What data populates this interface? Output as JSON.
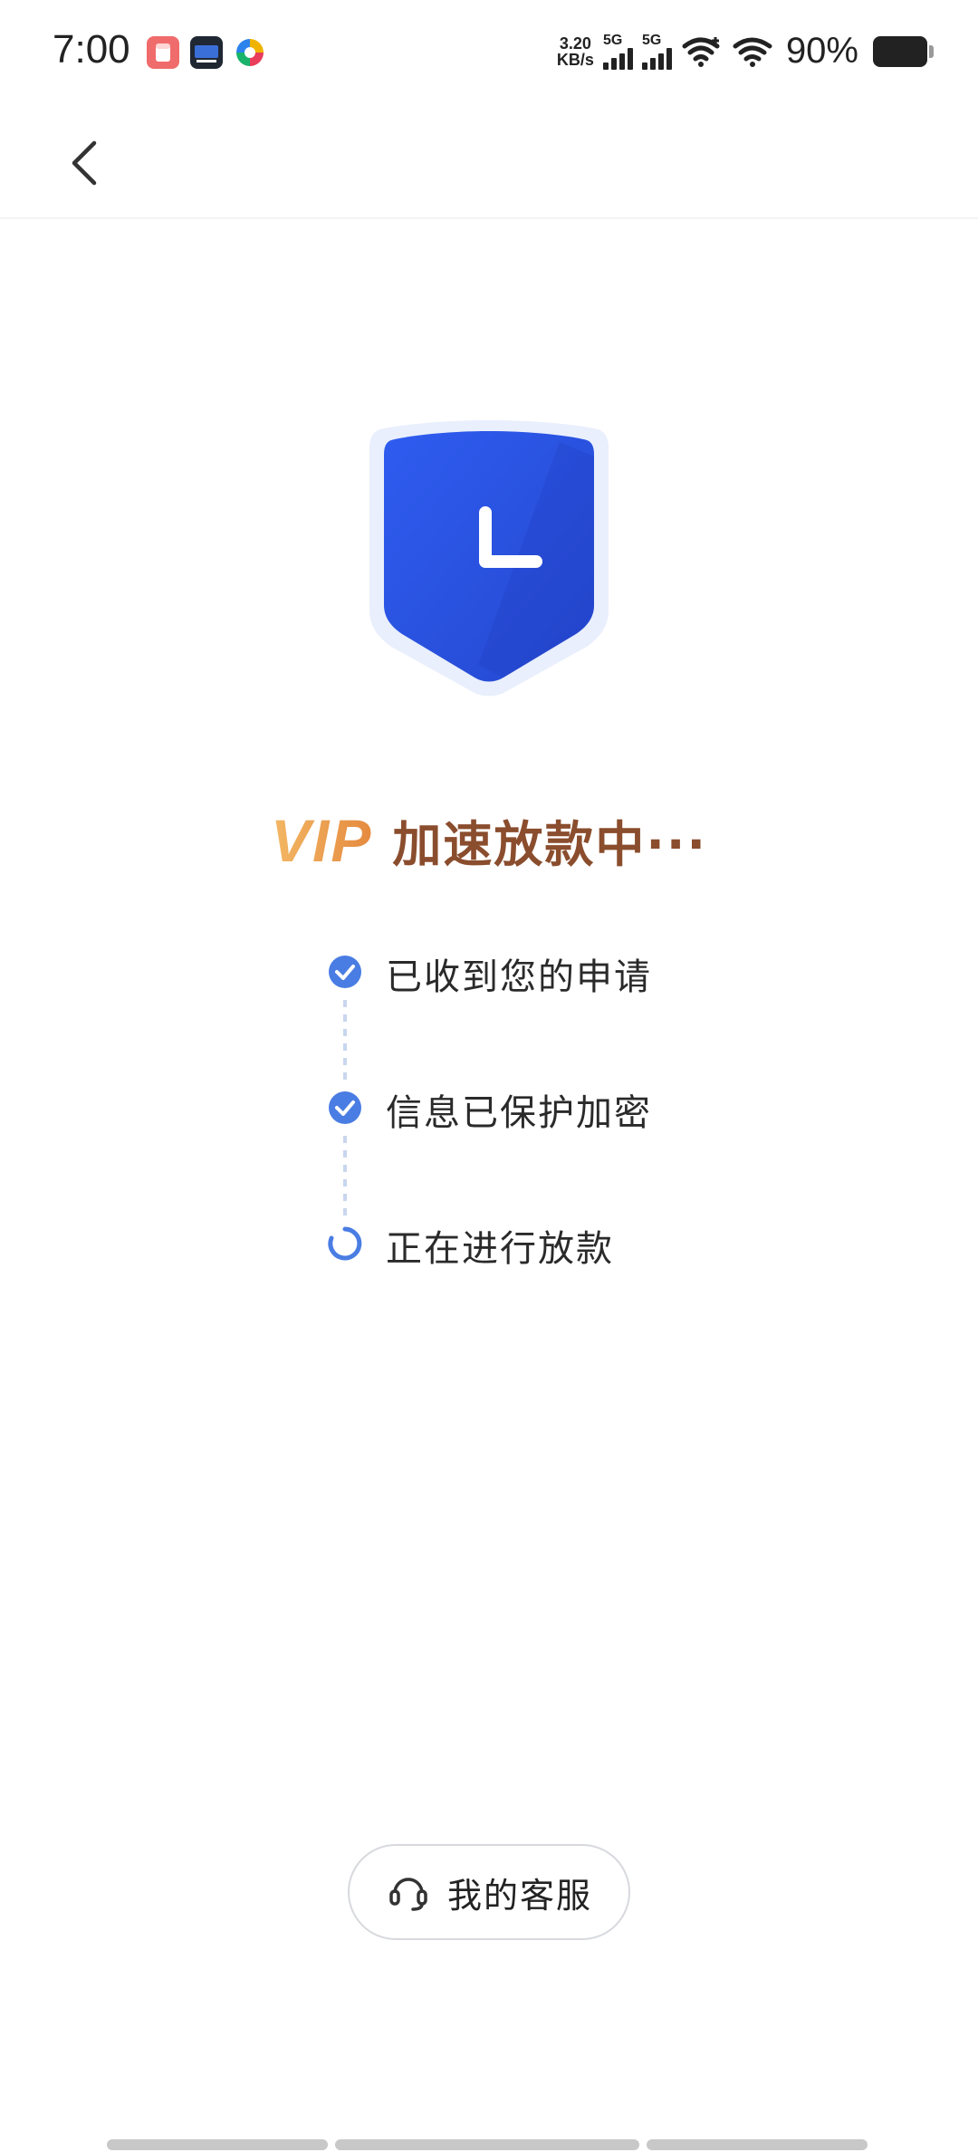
{
  "status_bar": {
    "time": "7:00",
    "net_speed_value": "3.20",
    "net_speed_unit": "KB/s",
    "sim1_label": "5G",
    "sim2_label": "5G",
    "battery_percent": "90%",
    "notification_icons": [
      "red-app-icon",
      "dark-app-icon",
      "colorful-app-icon"
    ]
  },
  "nav": {
    "back_icon": "chevron-left-icon"
  },
  "hero": {
    "icon": "shield-clock-icon",
    "vip_tag": "VIP",
    "title": "加速放款中···"
  },
  "steps": [
    {
      "label": "已收到您的申请",
      "state": "done"
    },
    {
      "label": "信息已保护加密",
      "state": "done"
    },
    {
      "label": "正在进行放款",
      "state": "in-progress"
    }
  ],
  "service_button": {
    "label": "我的客服",
    "icon": "headset-icon"
  },
  "colors": {
    "shield_blue": "#2d58e6",
    "step_blue": "#4a7de3",
    "title_brown": "#8a4d2d",
    "vip_orange": "#e58a3f"
  }
}
